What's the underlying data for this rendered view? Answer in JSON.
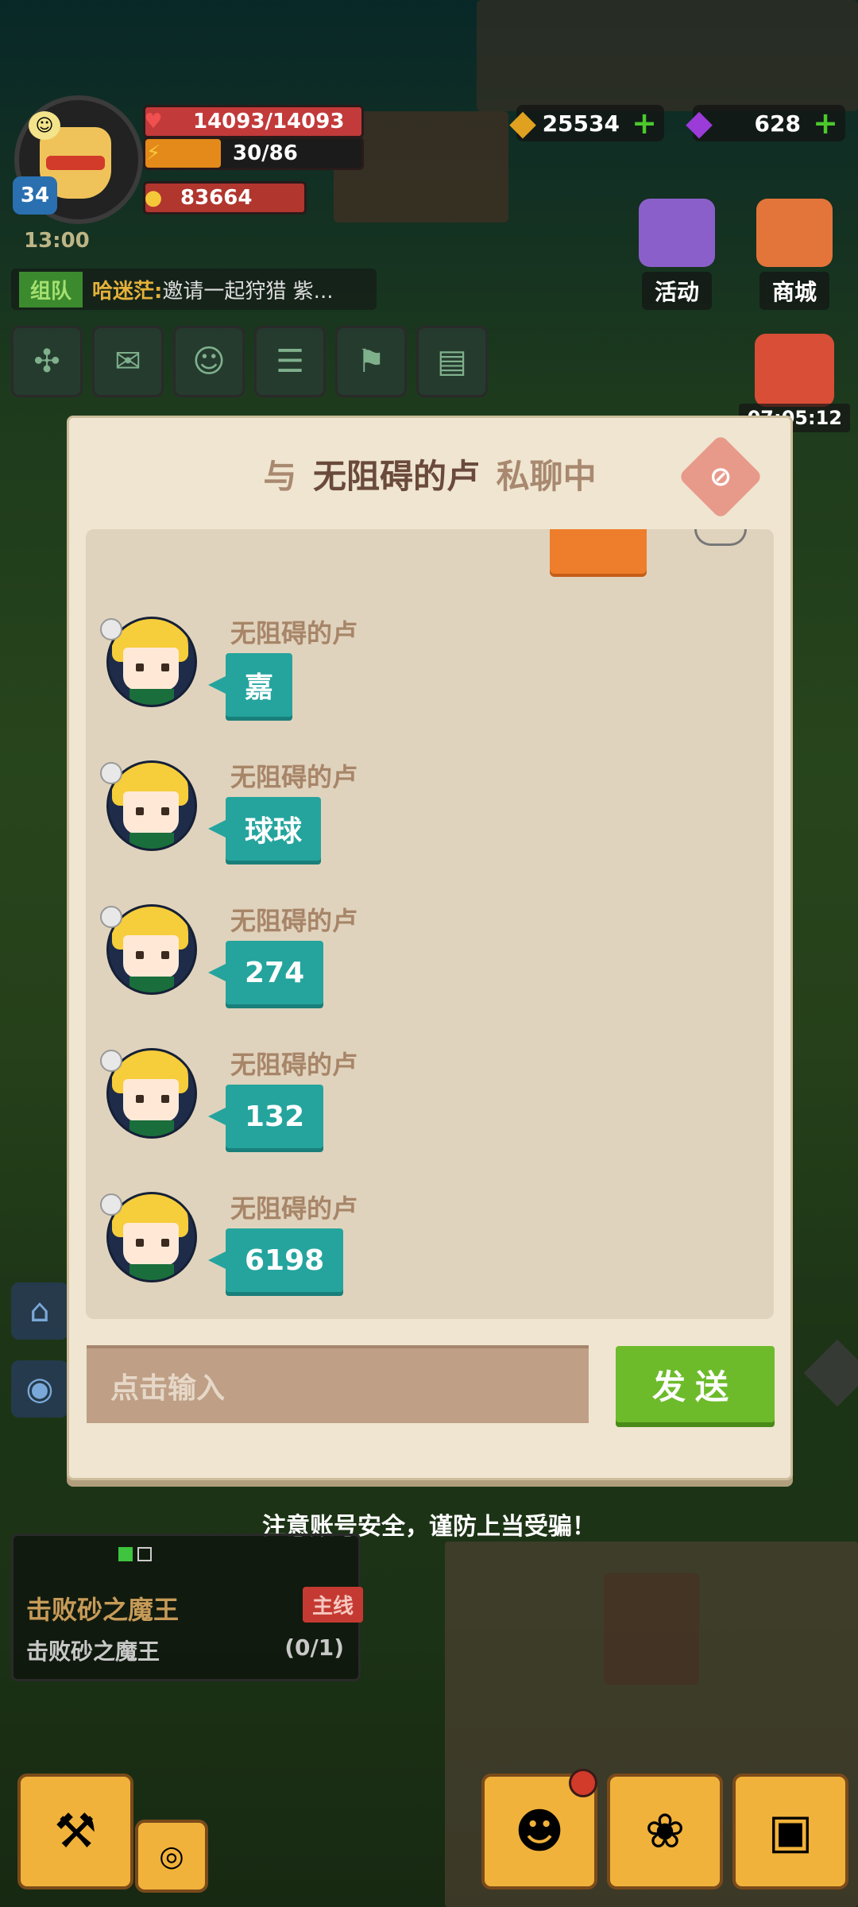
{
  "hud": {
    "level": "34",
    "hp": "14093/14093",
    "energy": "30/86",
    "energy_fraction": 0.35,
    "gold": "83664",
    "timer": "13:00",
    "coins": "25534",
    "gems": "628",
    "coin_icon": "diamond-coin-icon",
    "gem_icon": "purple-gem-icon"
  },
  "team": {
    "tag": "组队",
    "name": "哈迷茫:",
    "message": "邀请一起狩猎 紫..."
  },
  "events": {
    "activity_label": "活动",
    "shop_label": "商城",
    "gift_timer": "07:05:12"
  },
  "chat": {
    "title_prefix": "与",
    "title_name": "无阻碍的卢",
    "title_suffix": "私聊中",
    "messages": [
      {
        "sender": "无阻碍的卢",
        "text": "嘉"
      },
      {
        "sender": "无阻碍的卢",
        "text": "球球"
      },
      {
        "sender": "无阻碍的卢",
        "text": "274"
      },
      {
        "sender": "无阻碍的卢",
        "text": "132"
      },
      {
        "sender": "无阻碍的卢",
        "text": "6198"
      }
    ],
    "input_placeholder": "点击输入",
    "send_label": "发送"
  },
  "warning": "注意账号安全，谨防上当受骗！",
  "quest": {
    "title": "击败砂之魔王",
    "tag": "主线",
    "desc": "击败砂之魔王",
    "progress": "(0/1)"
  },
  "colors": {
    "teal_bubble": "#25a49e",
    "send_green": "#6dbb2b",
    "modal_bg": "#efe5d0"
  }
}
